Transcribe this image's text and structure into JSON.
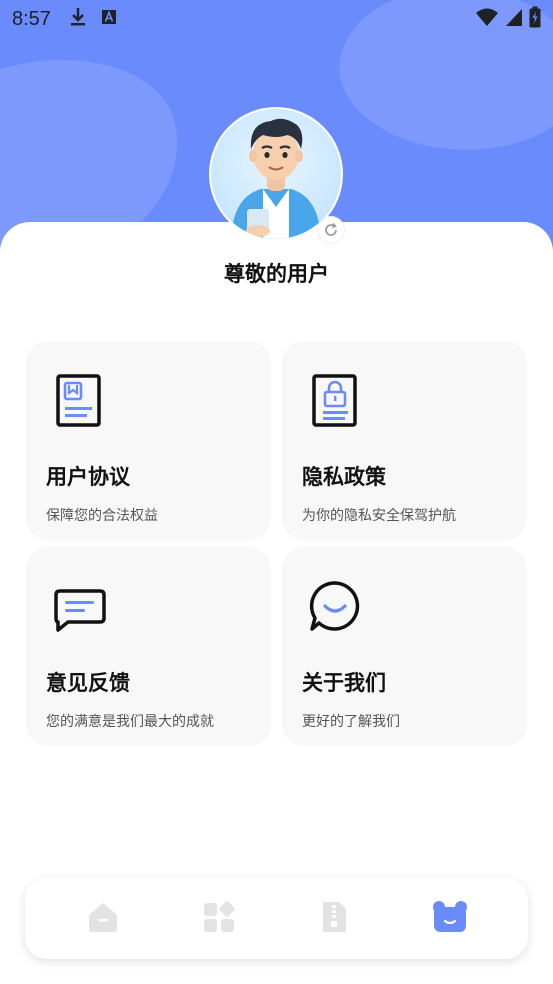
{
  "status_bar": {
    "time": "8:57",
    "icons_left": [
      "download-icon",
      "a-badge-icon"
    ],
    "icons_right": [
      "wifi-icon",
      "signal-icon",
      "battery-charging-icon"
    ]
  },
  "profile": {
    "username": "尊敬的用户",
    "avatar": "cartoon-user-avatar",
    "badge_icon": "refresh-icon"
  },
  "cards": [
    {
      "icon": "document-bookmark-icon",
      "title": "用户协议",
      "subtitle": "保障您的合法权益"
    },
    {
      "icon": "document-lock-icon",
      "title": "隐私政策",
      "subtitle": "为你的隐私安全保驾护航"
    },
    {
      "icon": "message-icon",
      "title": "意见反馈",
      "subtitle": "您的满意是我们最大的成就"
    },
    {
      "icon": "smile-chat-icon",
      "title": "关于我们",
      "subtitle": "更好的了解我们"
    }
  ],
  "tabbar": {
    "items": [
      {
        "icon": "home-icon",
        "active": false
      },
      {
        "icon": "apps-icon",
        "active": false
      },
      {
        "icon": "archive-icon",
        "active": false
      },
      {
        "icon": "profile-bear-icon",
        "active": true
      }
    ]
  },
  "colors": {
    "header": "#6a8bfb",
    "accent": "#6a8bfb",
    "inactive_tab": "#e3e3e3",
    "card_bg": "#f8f8f8"
  }
}
